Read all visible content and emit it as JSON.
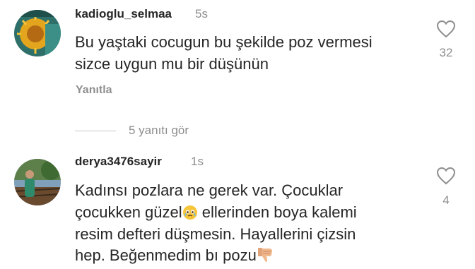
{
  "comments": [
    {
      "username": "kadioglu_selmaa",
      "time": "5s",
      "lines": [
        "Bu yaştaki cocugun bu şekilde poz vermesi",
        "sizce uygun mu bir düşünün"
      ],
      "reply_label": "Yanıtla",
      "likes": "32"
    },
    {
      "username": "derya3476sayir",
      "time": "1s",
      "line1": "Kadınsı pozlara ne gerek var. Çocuklar",
      "line2a": "çocukken güzel",
      "line2b": " ellerinden boya kalemi",
      "line3": "resim defteri düşmesin.  Hayallerini çizsin",
      "line4": "hep. Beğenmedim bı pozu",
      "likes": "4"
    }
  ],
  "view_replies": "5 yanıtı gör",
  "colors": {
    "primary_text": "#262626",
    "secondary_text": "#8e8e8e",
    "divider": "#c7c7c7"
  }
}
